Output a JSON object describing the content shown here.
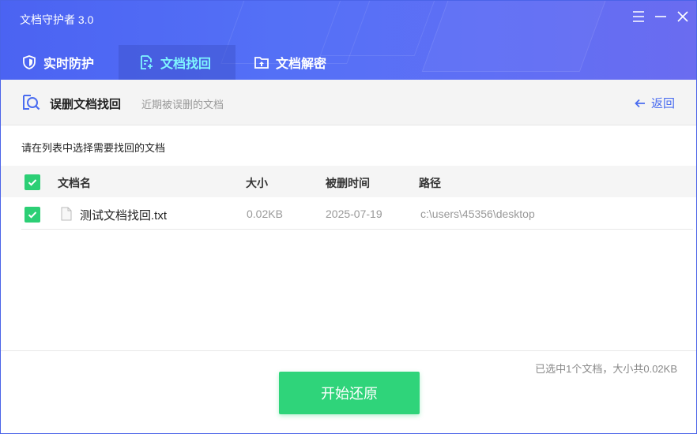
{
  "app": {
    "title": "文档守护者 3.0"
  },
  "colors": {
    "primary": "#4b63f2",
    "active_tab_text": "#7ff5ff",
    "green": "#2fd47a",
    "link": "#4a6cf0"
  },
  "window_controls": [
    {
      "name": "menu-icon"
    },
    {
      "name": "minimize-icon"
    },
    {
      "name": "close-icon"
    }
  ],
  "tabs": [
    {
      "label": "实时防护",
      "icon": "shield-icon",
      "active": false
    },
    {
      "label": "文档找回",
      "icon": "document-recover-icon",
      "active": true
    },
    {
      "label": "文档解密",
      "icon": "folder-unlock-icon",
      "active": false
    }
  ],
  "subheader": {
    "icon": "search-document-icon",
    "title": "误删文档找回",
    "description": "近期被误删的文档",
    "back_label": "返回"
  },
  "instruction": "请在列表中选择需要找回的文档",
  "table": {
    "select_all_checked": true,
    "columns": [
      "文档名",
      "大小",
      "被删时间",
      "路径"
    ],
    "rows": [
      {
        "checked": true,
        "name": "测试文档找回.txt",
        "size": "0.02KB",
        "deleted_time": "2025-07-19",
        "path": "c:\\users\\45356\\desktop"
      }
    ]
  },
  "summary": "已选中1个文档，大小共0.02KB",
  "start_button": "开始还原"
}
